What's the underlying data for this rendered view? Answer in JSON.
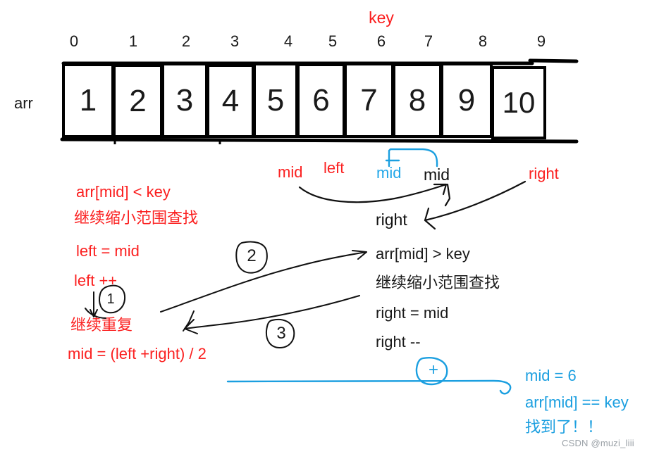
{
  "diagram": {
    "key_label": "key",
    "arr_label": "arr",
    "indices": [
      "0",
      "1",
      "2",
      "3",
      "4",
      "5",
      "6",
      "7",
      "8",
      "9"
    ],
    "cells": [
      "1",
      "2",
      "3",
      "4",
      "5",
      "6",
      "7",
      "8",
      "9",
      "10"
    ],
    "pointer_labels": {
      "mid_red": "mid",
      "left_red": "left",
      "mid_cyan": "mid",
      "mid_black": "mid",
      "right_red": "right",
      "right_black": "right"
    },
    "step_markers": [
      "1",
      "2",
      "3",
      "+"
    ],
    "left_block": {
      "line1": "arr[mid] < key",
      "line2": "继续缩小范围查找",
      "line3": "left = mid",
      "line4": "left ++",
      "line5": "继续重复",
      "line6": "mid = (left +right) / 2"
    },
    "right_block": {
      "line1": "arr[mid] > key",
      "line2": "继续缩小范围查找",
      "line3": "right = mid",
      "line4": "right --"
    },
    "result_block": {
      "line1": "mid = 6",
      "line2": "arr[mid]  == key",
      "line3": "找到了！！"
    },
    "watermark": "CSDN @muzi_liii",
    "colors": {
      "red": "#fb2020",
      "black": "#1a1a1a",
      "cyan": "#1b9fe0",
      "watermark": "#9aa0a6"
    }
  }
}
